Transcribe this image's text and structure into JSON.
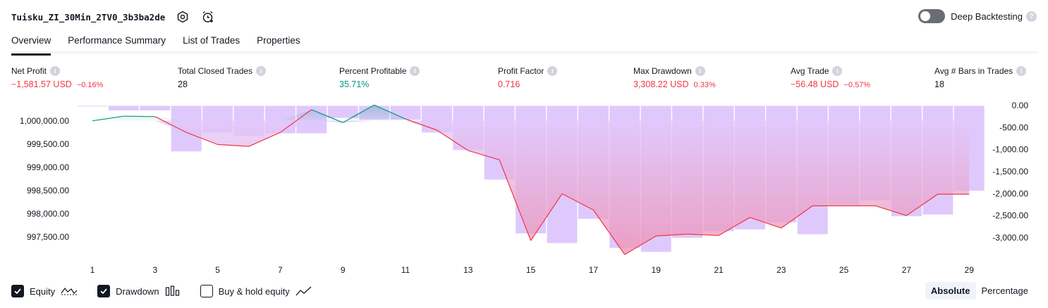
{
  "header": {
    "title": "Tuisku_ZI_30Min_2TV0_3b3ba2de",
    "deep_backtesting_label": "Deep Backtesting",
    "deep_backtesting_enabled": false
  },
  "tabs": [
    {
      "label": "Overview",
      "active": true
    },
    {
      "label": "Performance Summary",
      "active": false
    },
    {
      "label": "List of Trades",
      "active": false
    },
    {
      "label": "Properties",
      "active": false
    }
  ],
  "metrics": [
    {
      "label": "Net Profit",
      "value": "−1,581.57 USD",
      "pct": "−0.16%",
      "tone": "neg"
    },
    {
      "label": "Total Closed Trades",
      "value": "28",
      "pct": "",
      "tone": "neu"
    },
    {
      "label": "Percent Profitable",
      "value": "35.71%",
      "pct": "",
      "tone": "pos"
    },
    {
      "label": "Profit Factor",
      "value": "0.716",
      "pct": "",
      "tone": "neg"
    },
    {
      "label": "Max Drawdown",
      "value": "3,308.22 USD",
      "pct": "0.33%",
      "tone": "neg"
    },
    {
      "label": "Avg Trade",
      "value": "−56.48 USD",
      "pct": "−0.57%",
      "tone": "neg"
    },
    {
      "label": "Avg # Bars in Trades",
      "value": "18",
      "pct": "",
      "tone": "neu"
    }
  ],
  "chart_data": {
    "type": "line",
    "x_ticks": [
      "1",
      "3",
      "5",
      "7",
      "9",
      "11",
      "13",
      "15",
      "17",
      "19",
      "21",
      "23",
      "25",
      "27",
      "29"
    ],
    "left_axis": {
      "ticks": [
        "1,000,000.00",
        "999,500.00",
        "999,000.00",
        "998,500.00",
        "998,000.00",
        "997,500.00"
      ],
      "tick_values": [
        1000000,
        999500,
        999000,
        998500,
        998000,
        997500
      ],
      "range": [
        997150,
        1000330
      ]
    },
    "right_axis": {
      "ticks": [
        "0.00",
        "-500.00",
        "-1,000.00",
        "-1,500.00",
        "-2,000.00",
        "-2,500.00",
        "-3,000.00"
      ],
      "tick_values": [
        0,
        -500,
        -1000,
        -1500,
        -2000,
        -2500,
        -3000
      ],
      "range": [
        -3350,
        0
      ]
    },
    "series": [
      {
        "name": "Equity",
        "x": [
          1,
          2,
          3,
          4,
          5,
          6,
          7,
          8,
          9,
          10,
          11,
          12,
          13,
          14,
          15,
          16,
          17,
          18,
          19,
          20,
          21,
          22,
          23,
          24,
          25,
          26,
          27,
          28,
          29
        ],
        "values": [
          1000000,
          1000100,
          1000090,
          999750,
          999490,
          999450,
          999750,
          1000240,
          999960,
          1000340,
          1000040,
          999800,
          999360,
          999160,
          997420,
          998430,
          998080,
          997120,
          997520,
          997560,
          997530,
          997920,
          997690,
          998170,
          998170,
          998170,
          997960,
          998420,
          998420
        ]
      },
      {
        "name": "Drawdown",
        "x": [
          1,
          2,
          3,
          4,
          5,
          6,
          7,
          8,
          9,
          10,
          11,
          12,
          13,
          14,
          15,
          16,
          17,
          18,
          19,
          20,
          21,
          22,
          23,
          24,
          25,
          26,
          27,
          28,
          29
        ],
        "values": [
          -30,
          -120,
          -120,
          -1050,
          -620,
          -700,
          -640,
          -640,
          -290,
          -330,
          -330,
          -620,
          -1020,
          -1690,
          -2910,
          -3130,
          -2580,
          -3240,
          -3330,
          -3010,
          -2860,
          -2820,
          -2660,
          -2930,
          -2260,
          -2160,
          -2520,
          -2480,
          -1940
        ]
      }
    ],
    "legend_position": "bottom-left"
  },
  "legend": [
    {
      "label": "Equity",
      "checked": true,
      "icon": "equity-line-icon"
    },
    {
      "label": "Drawdown",
      "checked": true,
      "icon": "drawdown-bars-icon"
    },
    {
      "label": "Buy & hold equity",
      "checked": false,
      "icon": "buy-hold-line-icon"
    }
  ],
  "mode": {
    "absolute_label": "Absolute",
    "percentage_label": "Percentage",
    "selected": "Absolute"
  },
  "colors": {
    "loss": "#f23645",
    "profit": "#089981",
    "drawdown_bar": "#c9a8fa",
    "text": "#131722"
  }
}
